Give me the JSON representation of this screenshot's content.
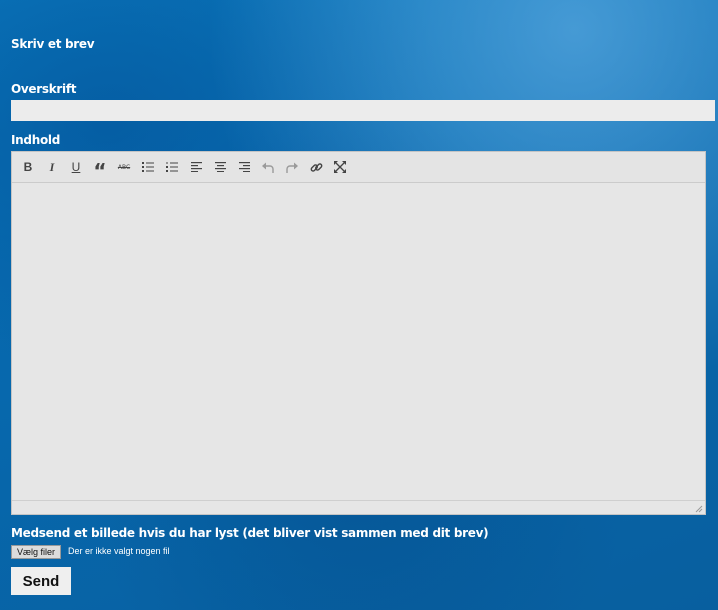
{
  "form": {
    "title": "Skriv et brev",
    "subject_label": "Overskrift",
    "subject_value": "",
    "content_label": "Indhold",
    "attachment_label": "Medsend et billede hvis du har lyst (det bliver vist sammen med dit brev)",
    "file_button_label": "Vælg filer",
    "file_status": "Der er ikke valgt nogen fil",
    "send_label": "Send"
  },
  "toolbar": {
    "bold": "B",
    "italic": "I",
    "underline": "U",
    "quote": "“",
    "strikethrough": "ABC"
  },
  "colors": {
    "background": "#0a72b6",
    "field": "#ececec",
    "editor": "#e6e6e6"
  }
}
